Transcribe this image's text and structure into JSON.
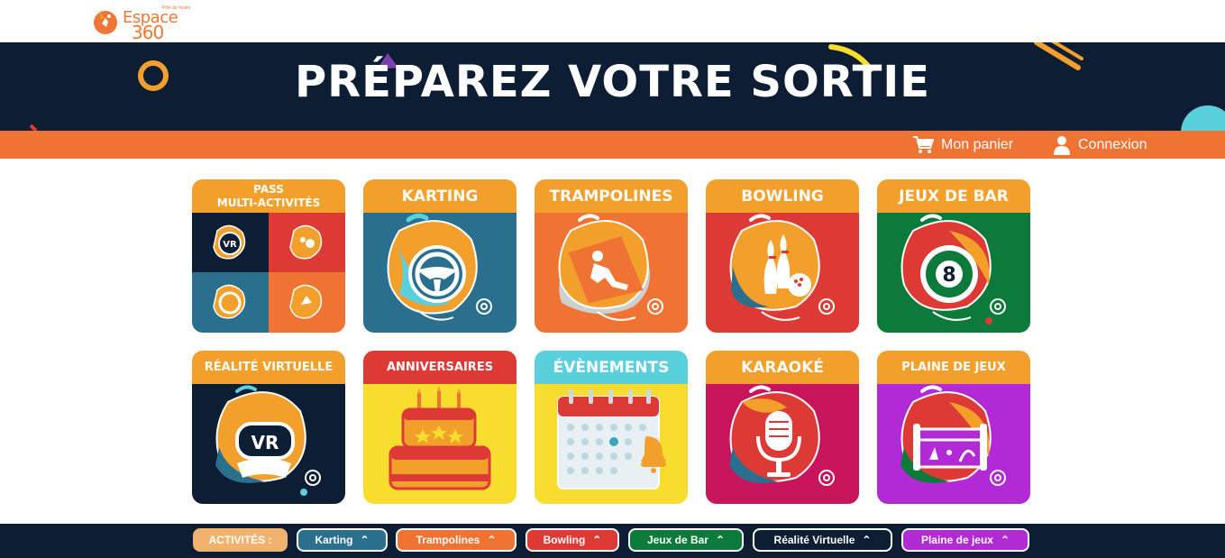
{
  "logo": {
    "name": "Espace",
    "number": "360",
    "tag": "Pôle de loisirs"
  },
  "hero": {
    "title": "PRÉPAREZ VOTRE SORTIE"
  },
  "nav": {
    "cart": "Mon panier",
    "login": "Connexion"
  },
  "tiles": [
    {
      "title_line1": "PASS",
      "title_line2": "MULTI-ACTIVITÉS",
      "head_color": "#f29f2b",
      "body_color": "#0d1d33"
    },
    {
      "title": "KARTING",
      "head_color": "#f29f2b",
      "body_color": "#2a6f8e"
    },
    {
      "title": "TRAMPOLINES",
      "head_color": "#f29f2b",
      "body_color": "#ef7333"
    },
    {
      "title": "BOWLING",
      "head_color": "#f29f2b",
      "body_color": "#dd3a35"
    },
    {
      "title": "JEUX DE BAR",
      "head_color": "#f29f2b",
      "body_color": "#0c7a3a"
    },
    {
      "title": "RÉALITÉ VIRTUELLE",
      "head_color": "#f29f2b",
      "body_color": "#0d1d33"
    },
    {
      "title": "ANNIVERSAIRES",
      "head_color": "#dd3a35",
      "body_color": "#f9dd2e"
    },
    {
      "title": "ÉVÈNEMENTS",
      "head_color": "#5bd0dd",
      "body_color": "#f9dd2e"
    },
    {
      "title": "KARAOKÉ",
      "head_color": "#f29f2b",
      "body_color": "#c8145a"
    },
    {
      "title": "PLAINE DE JEUX",
      "head_color": "#f29f2b",
      "body_color": "#b12ad6"
    }
  ],
  "vr_badge": "VR",
  "eight_ball": "8",
  "bottom": {
    "label": "ACTIVITÉS :",
    "pills": [
      {
        "label": "Karting",
        "color": "#2a6f8e"
      },
      {
        "label": "Trampolines",
        "color": "#ef7333"
      },
      {
        "label": "Bowling",
        "color": "#dd3a35"
      },
      {
        "label": "Jeux de Bar",
        "color": "#0c7a3a"
      },
      {
        "label": "Réalité Virtuelle",
        "color": "#0d1d33"
      },
      {
        "label": "Plaine de jeux",
        "color": "#b12ad6"
      }
    ]
  }
}
